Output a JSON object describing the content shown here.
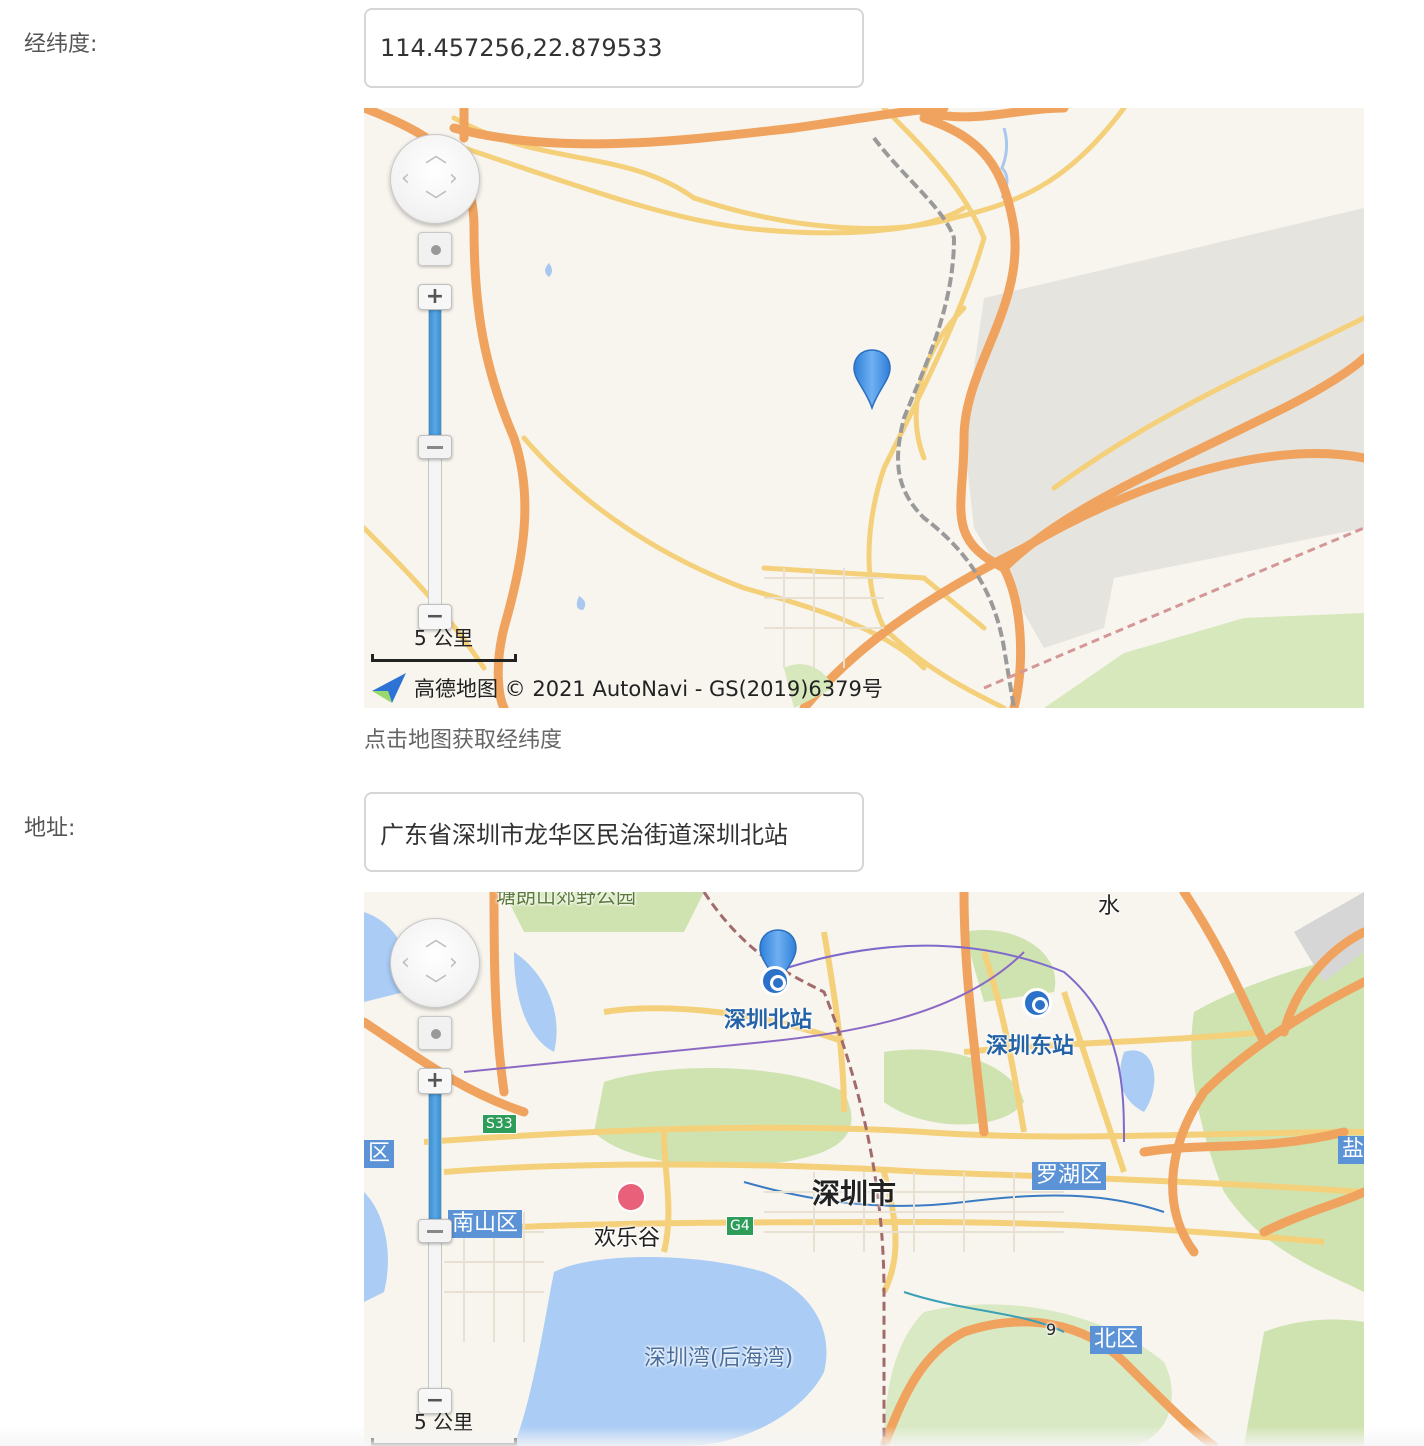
{
  "form": {
    "coords_label": "经纬度:",
    "coords_value": "114.457256,22.879533",
    "coords_help": "点击地图获取经纬度",
    "address_label": "地址:",
    "address_value": "广东省深圳市龙华区民治街道深圳北站"
  },
  "map1": {
    "scale_label": "5 公里",
    "copyright": "高德地图 © 2021 AutoNavi - GS(2019)6379号",
    "zoom_level_fraction": 0.48
  },
  "map2": {
    "scale_label": "5 公里",
    "zoom_level_fraction": 0.48,
    "labels": {
      "north_station": "深圳北站",
      "east_station": "深圳东站",
      "city": "深圳市",
      "luohu": "罗湖区",
      "nanshan": "南山区",
      "happy_valley": "欢乐谷",
      "bay": "深圳湾(后海湾)",
      "north_district": "北区",
      "district_edge": "区",
      "salt": "盐",
      "water": "水",
      "park": "塘朗山郊野公园",
      "s33": "S33",
      "g4": "G4",
      "nine": "9"
    }
  },
  "colors": {
    "map_bg": "#f8f5ee",
    "road_major": "#f0a35e",
    "road_minor": "#f5d07a",
    "pin_blue": "#3f8fe0",
    "green_area": "#cfe3b0",
    "water": "#aaccf5"
  },
  "icons": {
    "pin": "map-marker-icon",
    "pan": "pan-control-icon",
    "locate": "locate-icon",
    "zoom_in": "plus-icon",
    "zoom_out": "minus-icon",
    "logo": "amap-logo-icon",
    "station": "railway-station-icon",
    "poi": "ferris-wheel-icon"
  }
}
